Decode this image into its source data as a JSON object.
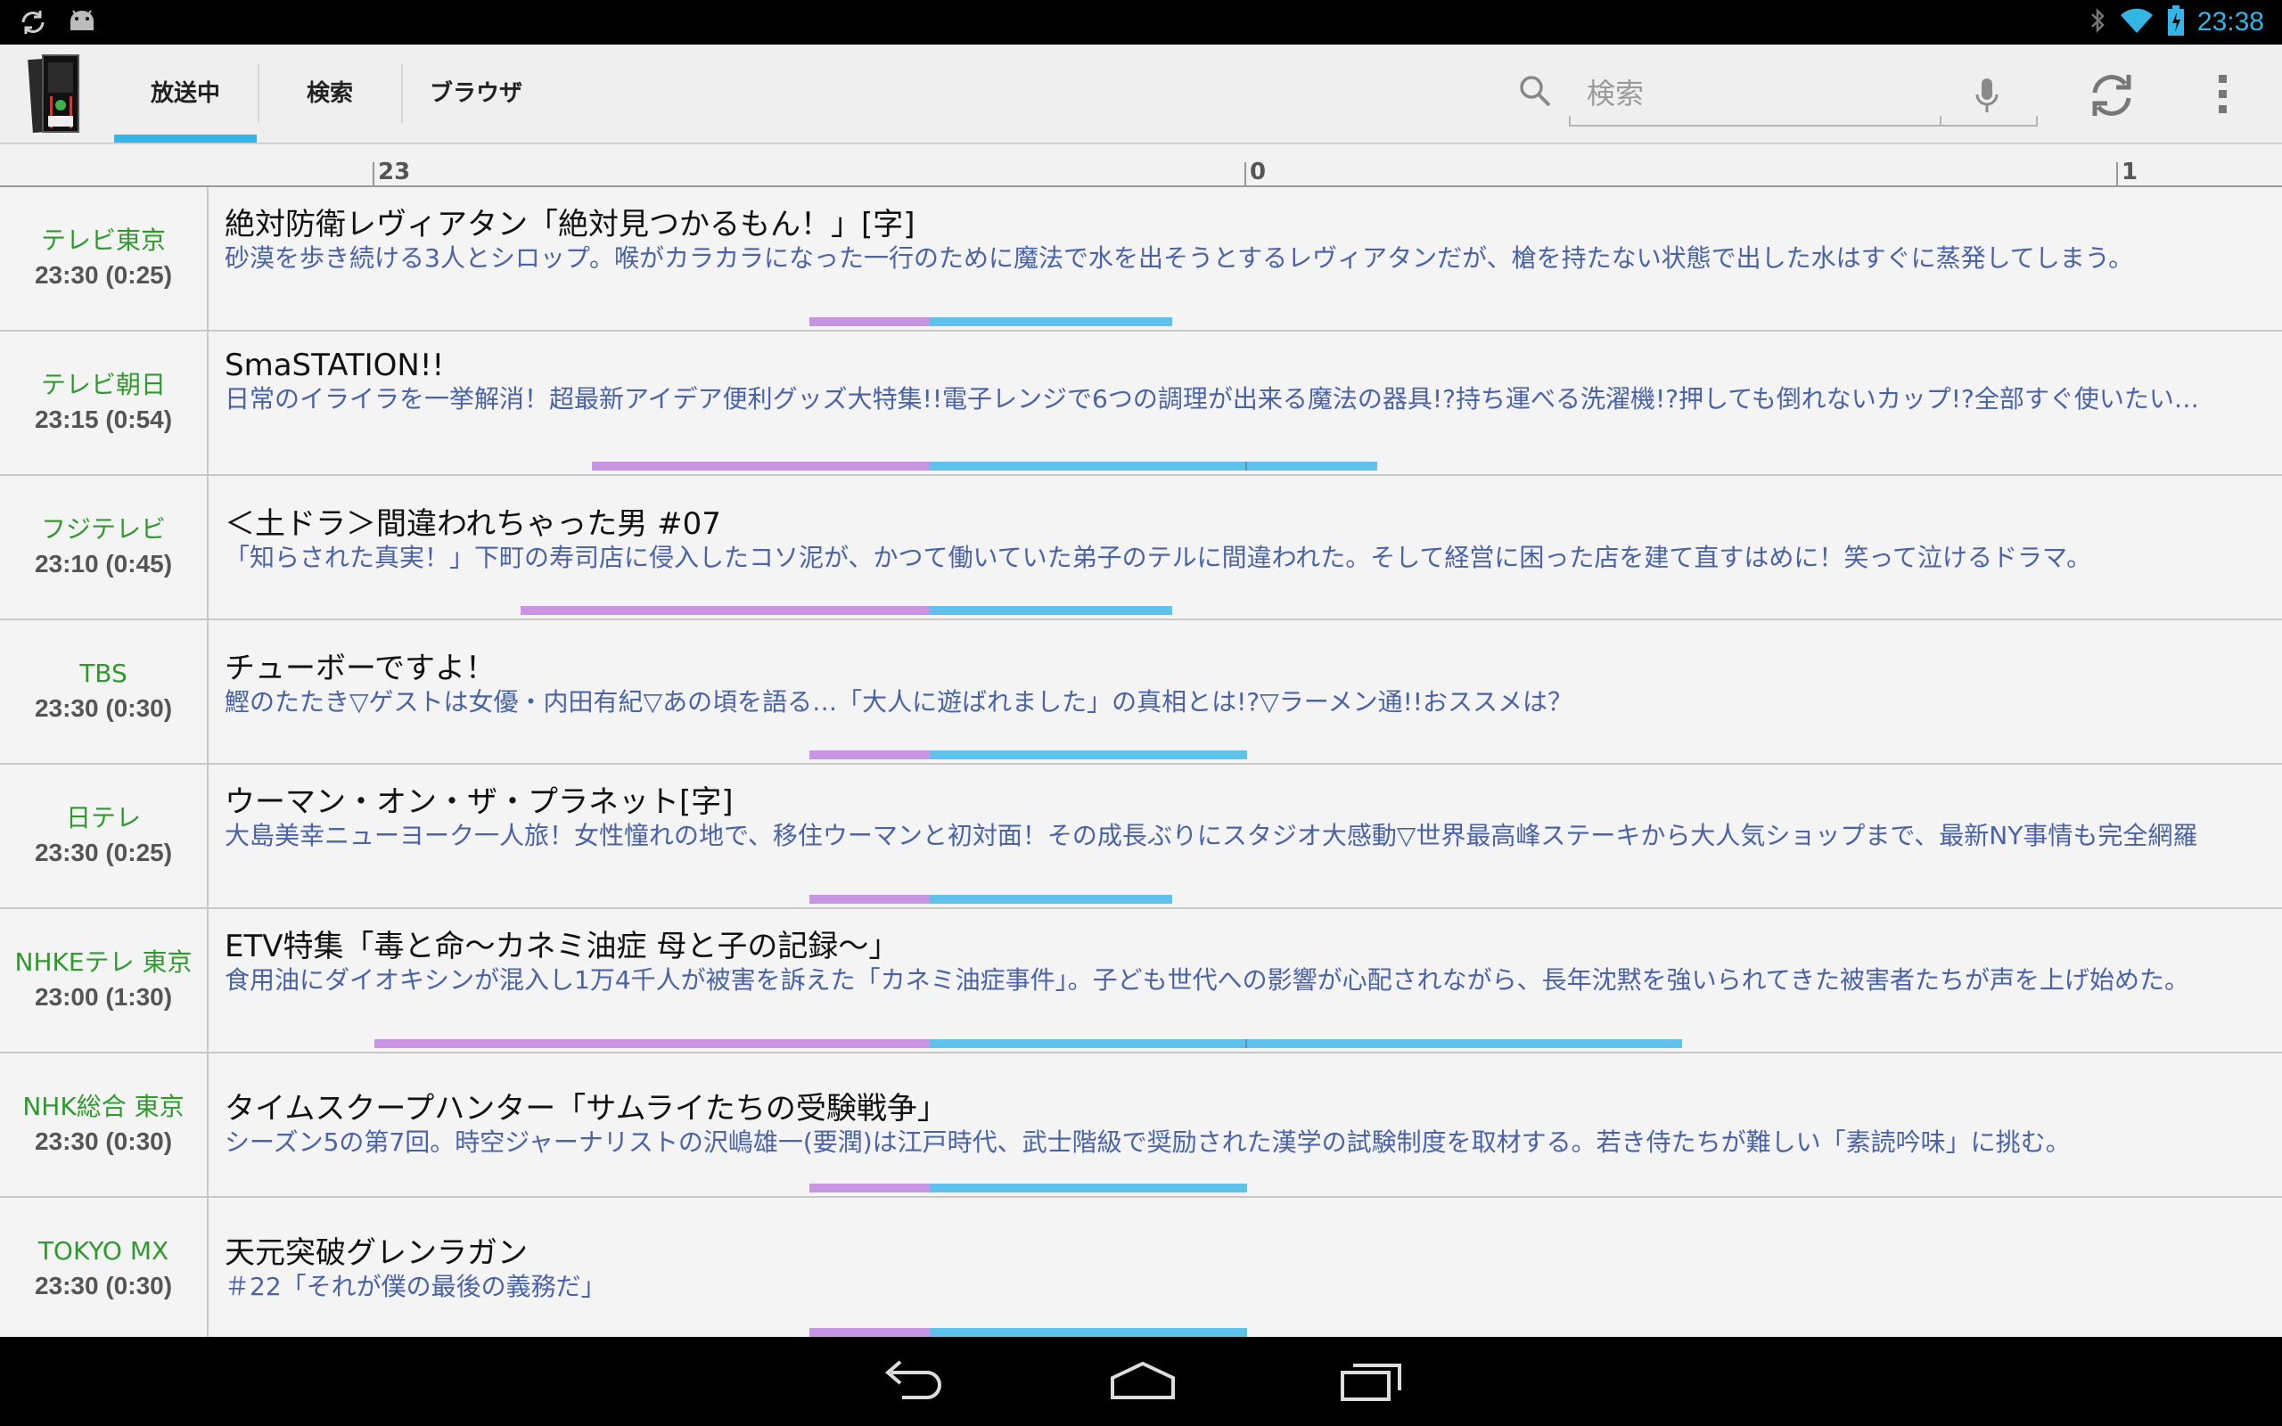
{
  "status": {
    "time": "23:38",
    "icons": [
      "sync-icon",
      "android-icon",
      "bluetooth-icon",
      "wifi-icon",
      "battery-icon"
    ]
  },
  "toolbar": {
    "tabs": [
      {
        "label": "放送中",
        "active": true
      },
      {
        "label": "検索",
        "active": false
      },
      {
        "label": "ブラウザ",
        "active": false
      }
    ],
    "search_placeholder": "検索"
  },
  "timeline": {
    "labels": [
      "23",
      "0",
      "1"
    ]
  },
  "colors": {
    "accent": "#33b5e5",
    "elapsed": "#c895e3",
    "remaining": "#5ec2ec",
    "channel": "#2e9a2e",
    "description": "#4a63a6"
  },
  "programs": [
    {
      "channel": "テレビ東京",
      "time": "23:30 (0:25)",
      "title": "絶対防衛レヴィアタン「絶対見つかるもん！」[字]",
      "description": "砂漠を歩き続ける3人とシロップ。喉がカラカラになった一行のために魔法で水を出そうとするレヴィアタンだが、槍を持たない状態で出した水はすぐに蒸発してしまう。",
      "start": "23:30",
      "duration_min": 25
    },
    {
      "channel": "テレビ朝日",
      "time": "23:15 (0:54)",
      "title": "SmaSTATION!!",
      "description": "日常のイライラを一挙解消！超最新アイデア便利グッズ大特集!!電子レンジで6つの調理が出来る魔法の器具!?持ち運べる洗濯機!?押しても倒れないカップ!?全部すぐ使いたい…",
      "start": "23:15",
      "duration_min": 54
    },
    {
      "channel": "フジテレビ",
      "time": "23:10 (0:45)",
      "title": "＜土ドラ＞間違われちゃった男 #07",
      "description": "「知らされた真実！」下町の寿司店に侵入したコソ泥が、かつて働いていた弟子のテルに間違われた。そして経営に困った店を建て直すはめに！笑って泣けるドラマ。",
      "start": "23:10",
      "duration_min": 45
    },
    {
      "channel": "TBS",
      "time": "23:30 (0:30)",
      "title": "チューボーですよ！",
      "description": "鰹のたたき▽ゲストは女優・内田有紀▽あの頃を語る…「大人に遊ばれました」の真相とは!?▽ラーメン通!!おススメは？",
      "start": "23:30",
      "duration_min": 30
    },
    {
      "channel": "日テレ",
      "time": "23:30 (0:25)",
      "title": "ウーマン・オン・ザ・プラネット[字]",
      "description": "大島美幸ニューヨーク一人旅！女性憧れの地で、移住ウーマンと初対面！その成長ぶりにスタジオ大感動▽世界最高峰ステーキから大人気ショップまで、最新NY事情も完全網羅",
      "start": "23:30",
      "duration_min": 25
    },
    {
      "channel": "NHKEテレ 東京",
      "time": "23:00 (1:30)",
      "title": "ETV特集「毒と命～カネミ油症 母と子の記録～」",
      "description": "食用油にダイオキシンが混入し1万4千人が被害を訴えた「カネミ油症事件」。子ども世代への影響が心配されながら、長年沈黙を強いられてきた被害者たちが声を上げ始めた。",
      "start": "23:00",
      "duration_min": 90
    },
    {
      "channel": "NHK総合 東京",
      "time": "23:30 (0:30)",
      "title": "タイムスクープハンター「サムライたちの受験戦争」",
      "description": "シーズン5の第7回。時空ジャーナリストの沢嶋雄一(要潤)は江戸時代、武士階級で奨励された漢学の試験制度を取材する。若き侍たちが難しい「素読吟味」に挑む。",
      "start": "23:30",
      "duration_min": 30
    },
    {
      "channel": "TOKYO MX",
      "time": "23:30 (0:30)",
      "title": "天元突破グレンラガン",
      "description": "＃22「それが僕の最後の義務だ」",
      "start": "23:30",
      "duration_min": 30
    }
  ]
}
